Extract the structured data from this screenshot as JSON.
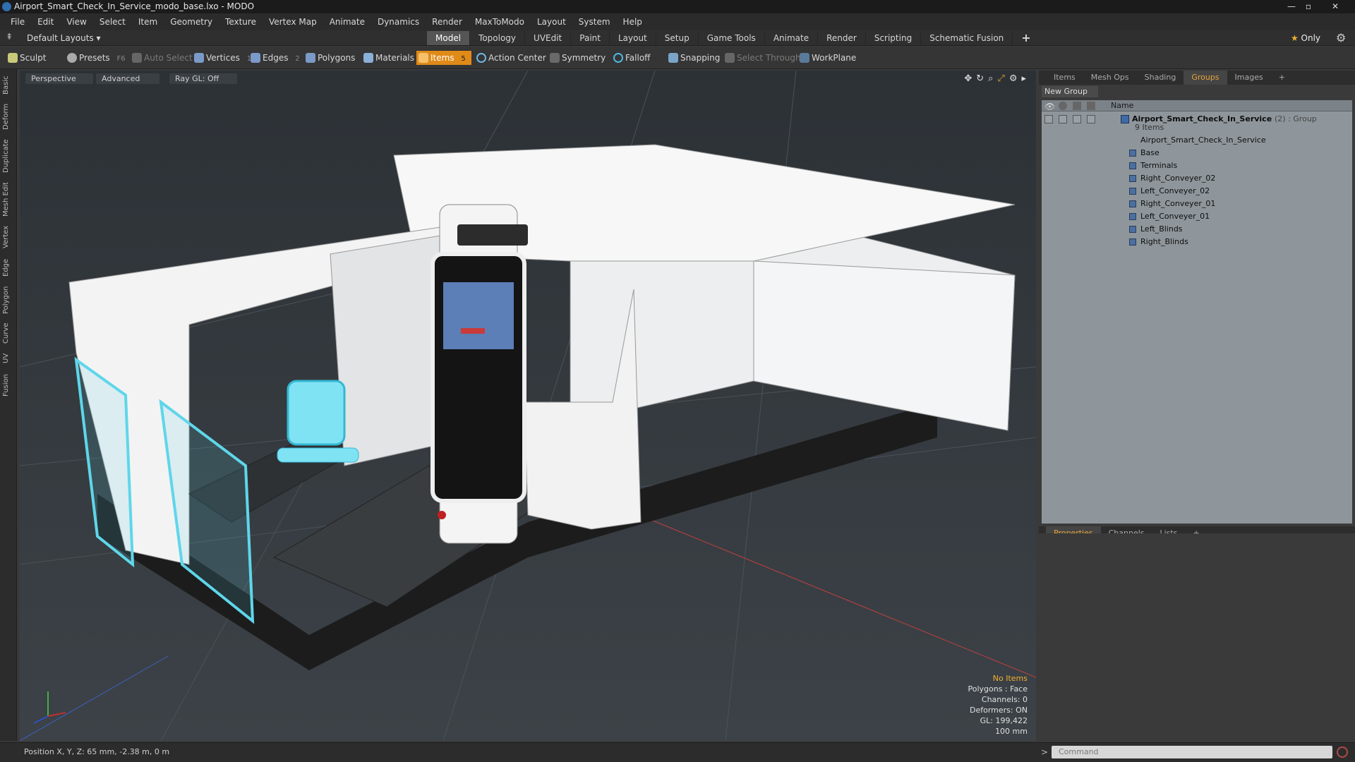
{
  "window": {
    "title": "Airport_Smart_Check_In_Service_modo_base.lxo - MODO",
    "buttons": [
      "—",
      "▫",
      "✕"
    ]
  },
  "menu": [
    "File",
    "Edit",
    "View",
    "Select",
    "Item",
    "Geometry",
    "Texture",
    "Vertex Map",
    "Animate",
    "Dynamics",
    "Render",
    "MaxToModo",
    "Layout",
    "System",
    "Help"
  ],
  "layout_bar": {
    "layout_select": "Default Layouts",
    "tabs": [
      "Model",
      "Topology",
      "UVEdit",
      "Paint",
      "Layout",
      "Setup",
      "Game Tools",
      "Animate",
      "Render",
      "Scripting",
      "Schematic Fusion"
    ],
    "active_tab": "Model",
    "only_label": "Only"
  },
  "toolbar": {
    "sculpt": "Sculpt",
    "presets": "Presets",
    "presets_key": "F6",
    "auto_select": "Auto Select",
    "vertices": "Vertices",
    "vertices_count": "1",
    "edges": "Edges",
    "edges_count": "2",
    "polygons": "Polygons",
    "materials": "Materials",
    "items": "Items",
    "items_count": "5",
    "action_center": "Action Center",
    "symmetry": "Symmetry",
    "falloff": "Falloff",
    "snapping": "Snapping",
    "select_through": "Select Through",
    "workplane": "WorkPlane"
  },
  "left_tabs": [
    "Basic",
    "Deform",
    "Duplicate",
    "Mesh Edit",
    "Vertex",
    "Edge",
    "Polygon",
    "Curve",
    "UV",
    "Fusion"
  ],
  "viewport": {
    "view_label": "Perspective",
    "shading_label": "Advanced",
    "raygl_label": "Ray GL: Off",
    "info": {
      "selection": "No Items",
      "polygons": "Polygons : Face",
      "channels": "Channels: 0",
      "deformers": "Deformers: ON",
      "gl": "GL: 199,422",
      "scale": "100 mm"
    }
  },
  "right_panel": {
    "top_tabs": [
      "Items",
      "Mesh Ops",
      "Shading",
      "Groups",
      "Images"
    ],
    "active_top_tab": "Groups",
    "new_group": "New Group",
    "name_header": "Name",
    "group": {
      "name": "Airport_Smart_Check_In_Service",
      "suffix": "(2) : Group",
      "count": "9 Items"
    },
    "items": [
      "Airport_Smart_Check_In_Service",
      "Base",
      "Terminals",
      "Right_Conveyer_02",
      "Left_Conveyer_02",
      "Right_Conveyer_01",
      "Left_Conveyer_01",
      "Left_Blinds",
      "Right_Blinds"
    ],
    "bottom_tabs": [
      "Properties",
      "Channels",
      "Lists"
    ],
    "active_bottom_tab": "Properties"
  },
  "status": {
    "position": "Position X, Y, Z:  65 mm, -2.38 m, 0 m",
    "command_placeholder": "Command"
  },
  "colors": {
    "accent": "#e08a18",
    "active_tab": "#e8a53a",
    "grid_bg": "#8f969b"
  }
}
